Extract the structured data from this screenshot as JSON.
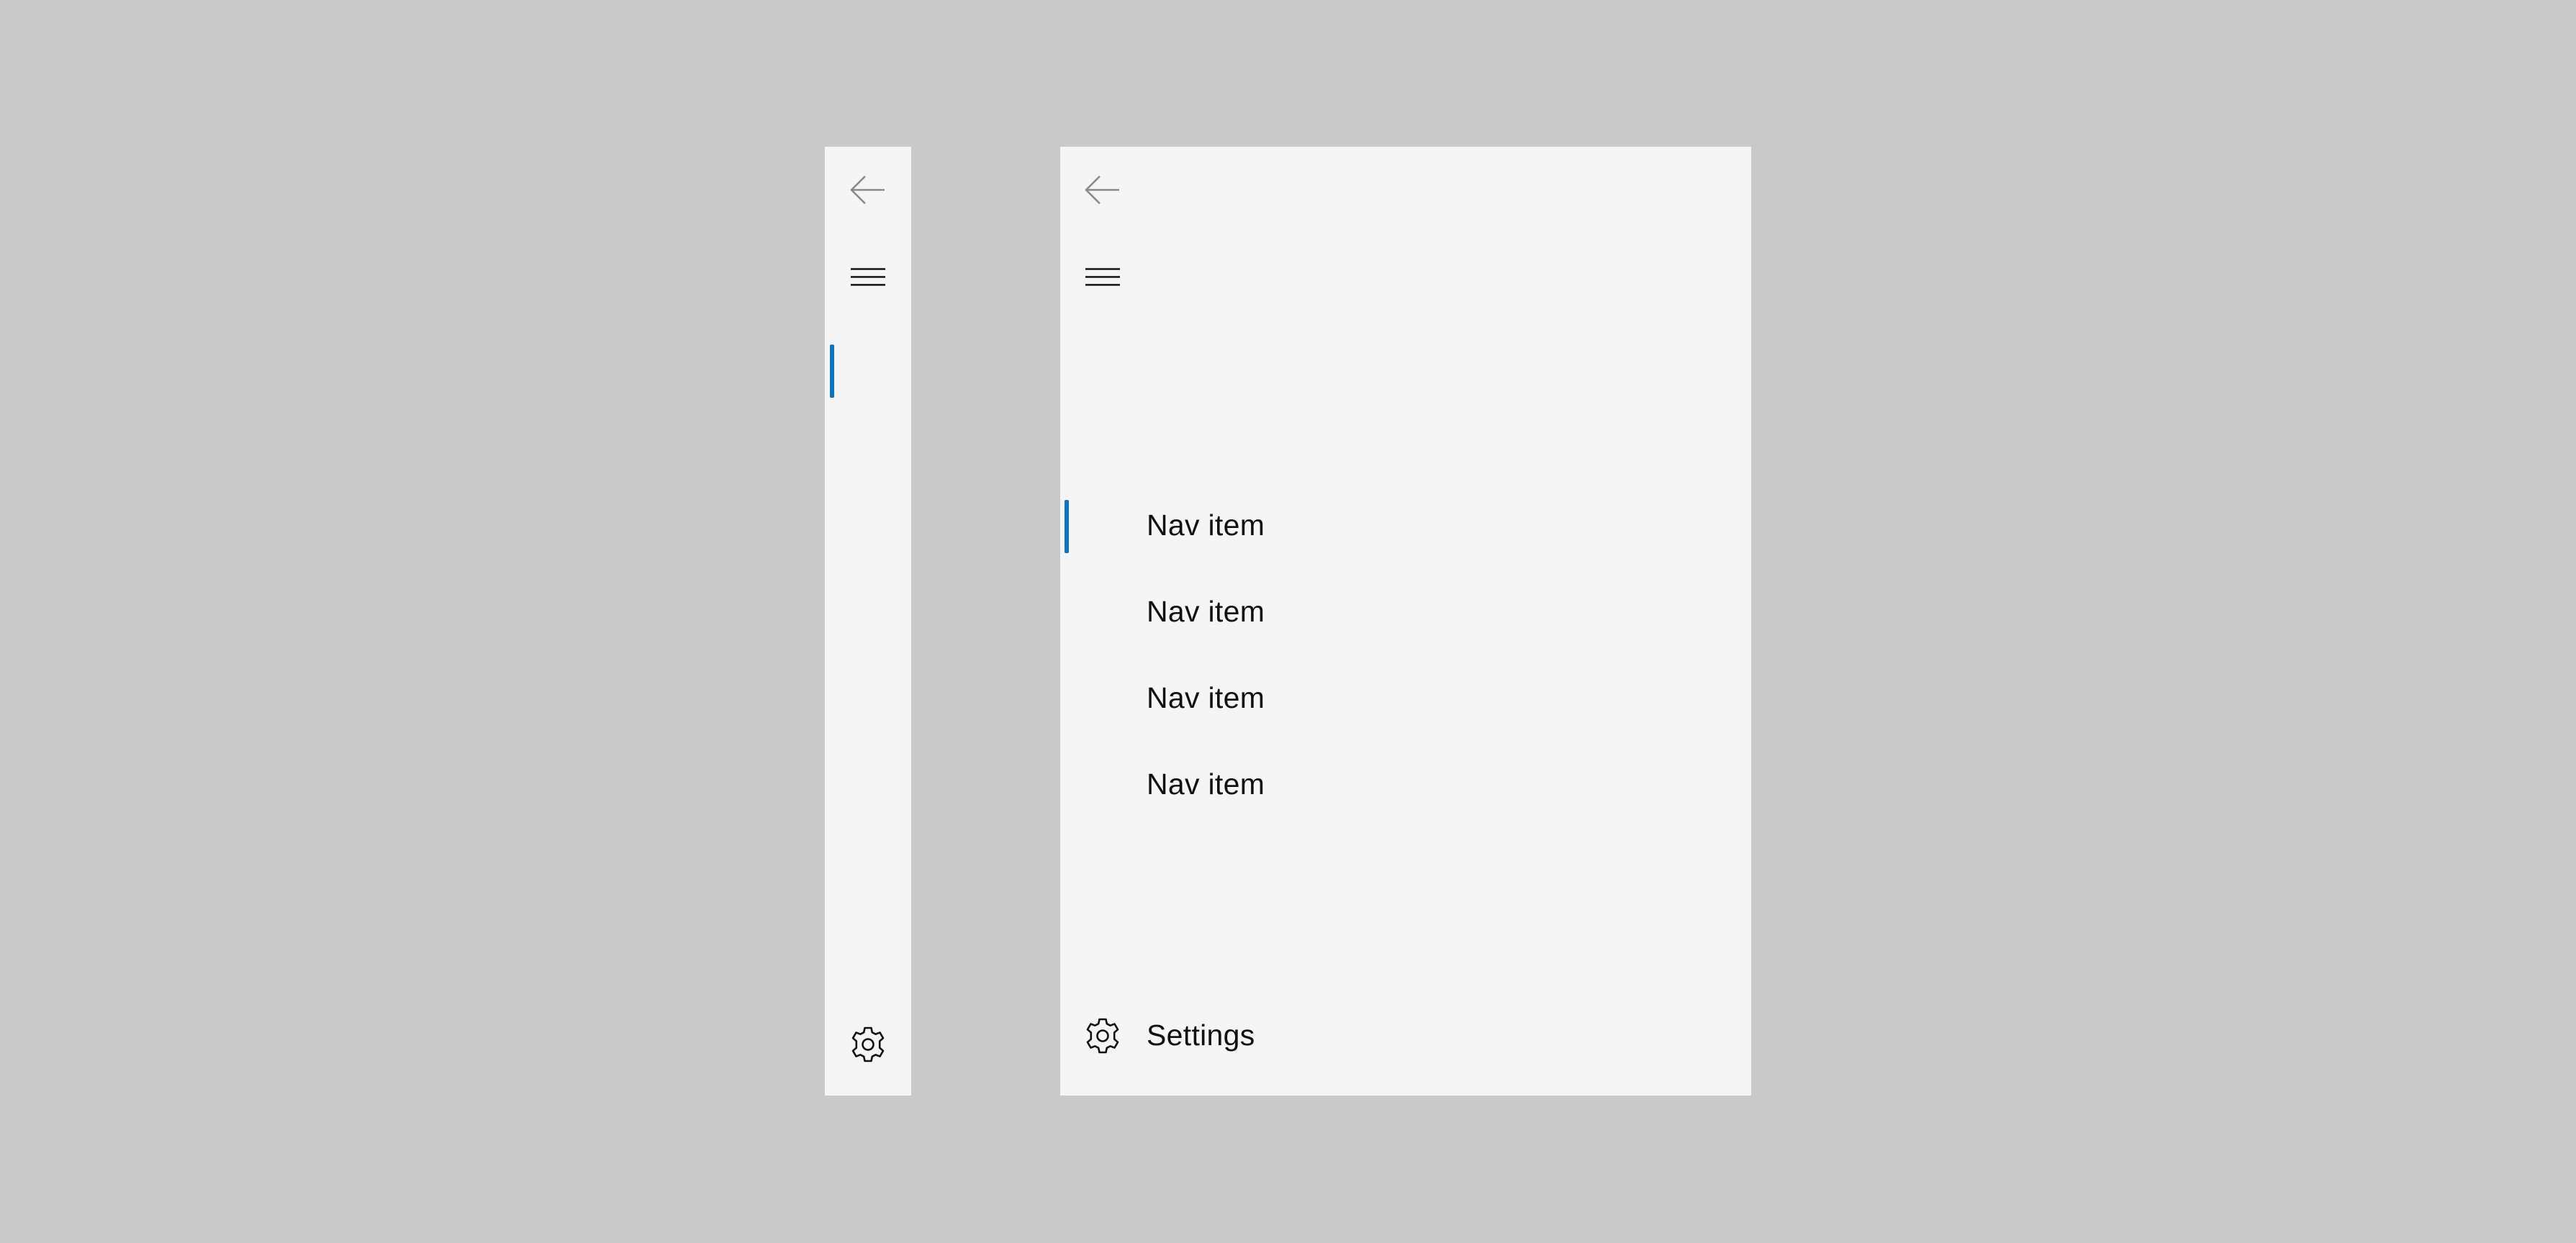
{
  "compact_pane": {
    "back_icon": "arrow-left-icon",
    "menu_icon": "hamburger-icon",
    "settings_icon": "gear-icon",
    "selected_index": 0
  },
  "expanded_pane": {
    "back_icon": "arrow-left-icon",
    "menu_icon": "hamburger-icon",
    "nav_items": [
      {
        "label": "Nav item",
        "selected": true
      },
      {
        "label": "Nav item",
        "selected": false
      },
      {
        "label": "Nav item",
        "selected": false
      },
      {
        "label": "Nav item",
        "selected": false
      }
    ],
    "settings": {
      "label": "Settings",
      "icon": "gear-icon"
    }
  },
  "colors": {
    "background": "#c9c9c9",
    "pane": "#f5f5f5",
    "accent": "#0a72c8",
    "text": "#111111",
    "back_arrow": "#8a8a8a"
  }
}
